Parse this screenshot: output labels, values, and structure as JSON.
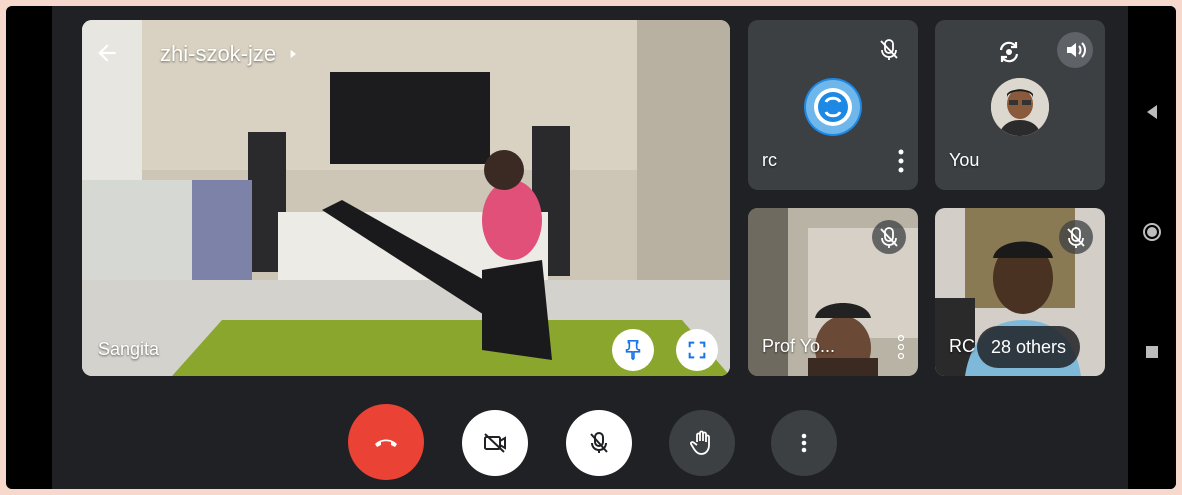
{
  "meeting": {
    "code": "zhi-szok-jze"
  },
  "main_tile": {
    "participant_name": "Sangita"
  },
  "tiles": [
    {
      "participant_name": "rc"
    },
    {
      "participant_name": "You"
    },
    {
      "participant_name": "Prof Yo..."
    },
    {
      "participant_name": "RC"
    }
  ],
  "others_badge": {
    "label": "28 others"
  },
  "colors": {
    "end_call": "#ea4335",
    "screen_bg": "#202124",
    "tile_bg": "#3c4043",
    "accent": "#1a73e8"
  },
  "controls": [
    "end-call",
    "camera-off",
    "mic-off",
    "raise-hand",
    "more-options"
  ]
}
